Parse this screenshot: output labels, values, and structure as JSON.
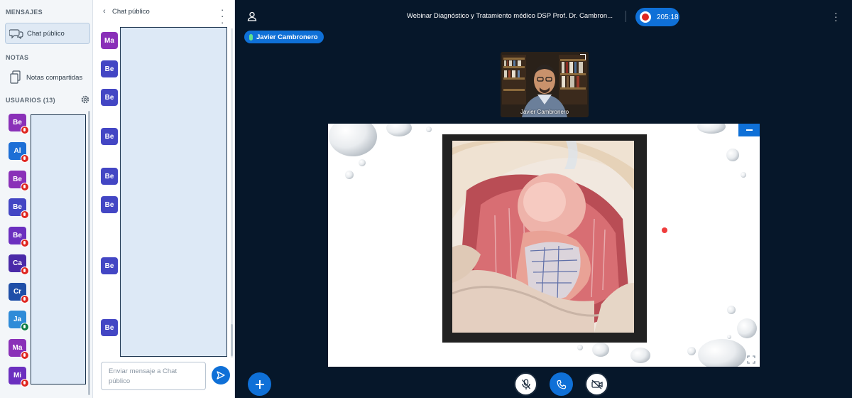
{
  "sidebar": {
    "messages_header": "MENSAJES",
    "public_chat_label": "Chat público",
    "notes_header": "NOTAS",
    "shared_notes_label": "Notas compartidas",
    "users_header": "USUARIOS (13)",
    "users": [
      {
        "initials": "Be",
        "color": "#8a30b8",
        "muted": true
      },
      {
        "initials": "Al",
        "color": "#1d6fd6",
        "muted": true
      },
      {
        "initials": "Be",
        "color": "#8a30b8",
        "muted": true
      },
      {
        "initials": "Be",
        "color": "#4346c4",
        "muted": true
      },
      {
        "initials": "Be",
        "color": "#6b2fbf",
        "muted": true
      },
      {
        "initials": "Ca",
        "color": "#4a2aa8",
        "muted": true
      },
      {
        "initials": "Cr",
        "color": "#1f4fa8",
        "muted": true
      },
      {
        "initials": "Ja",
        "color": "#2e8bd8",
        "muted": false
      },
      {
        "initials": "Ma",
        "color": "#8a30b8",
        "muted": true
      },
      {
        "initials": "Mi",
        "color": "#6b2fbf",
        "muted": true
      }
    ]
  },
  "chat": {
    "title": "Chat público",
    "input_placeholder": "Enviar mensaje a Chat público",
    "avatars": [
      {
        "initials": "Ma",
        "style": "purple"
      },
      {
        "initials": "Be",
        "style": "blue"
      },
      {
        "initials": "Be",
        "style": "blue"
      },
      {
        "initials": "Be",
        "style": "blue"
      },
      {
        "initials": "Be",
        "style": "blue"
      },
      {
        "initials": "Be",
        "style": "blue"
      },
      {
        "initials": "Be",
        "style": "blue"
      },
      {
        "initials": "Be",
        "style": "blue"
      }
    ]
  },
  "main": {
    "meeting_title": "Webinar Diagnóstico y Tratamiento médico DSP Prof. Dr. Cambron...",
    "recording_time": "205:18",
    "talker_name": "Javier Cambronero",
    "webcam_name": "Javier Cambronero"
  },
  "colors": {
    "accent": "#0f70d7",
    "dark_bg": "#06172a",
    "muted_badge": "#df2721",
    "unmuted_badge": "#0f7d45"
  }
}
